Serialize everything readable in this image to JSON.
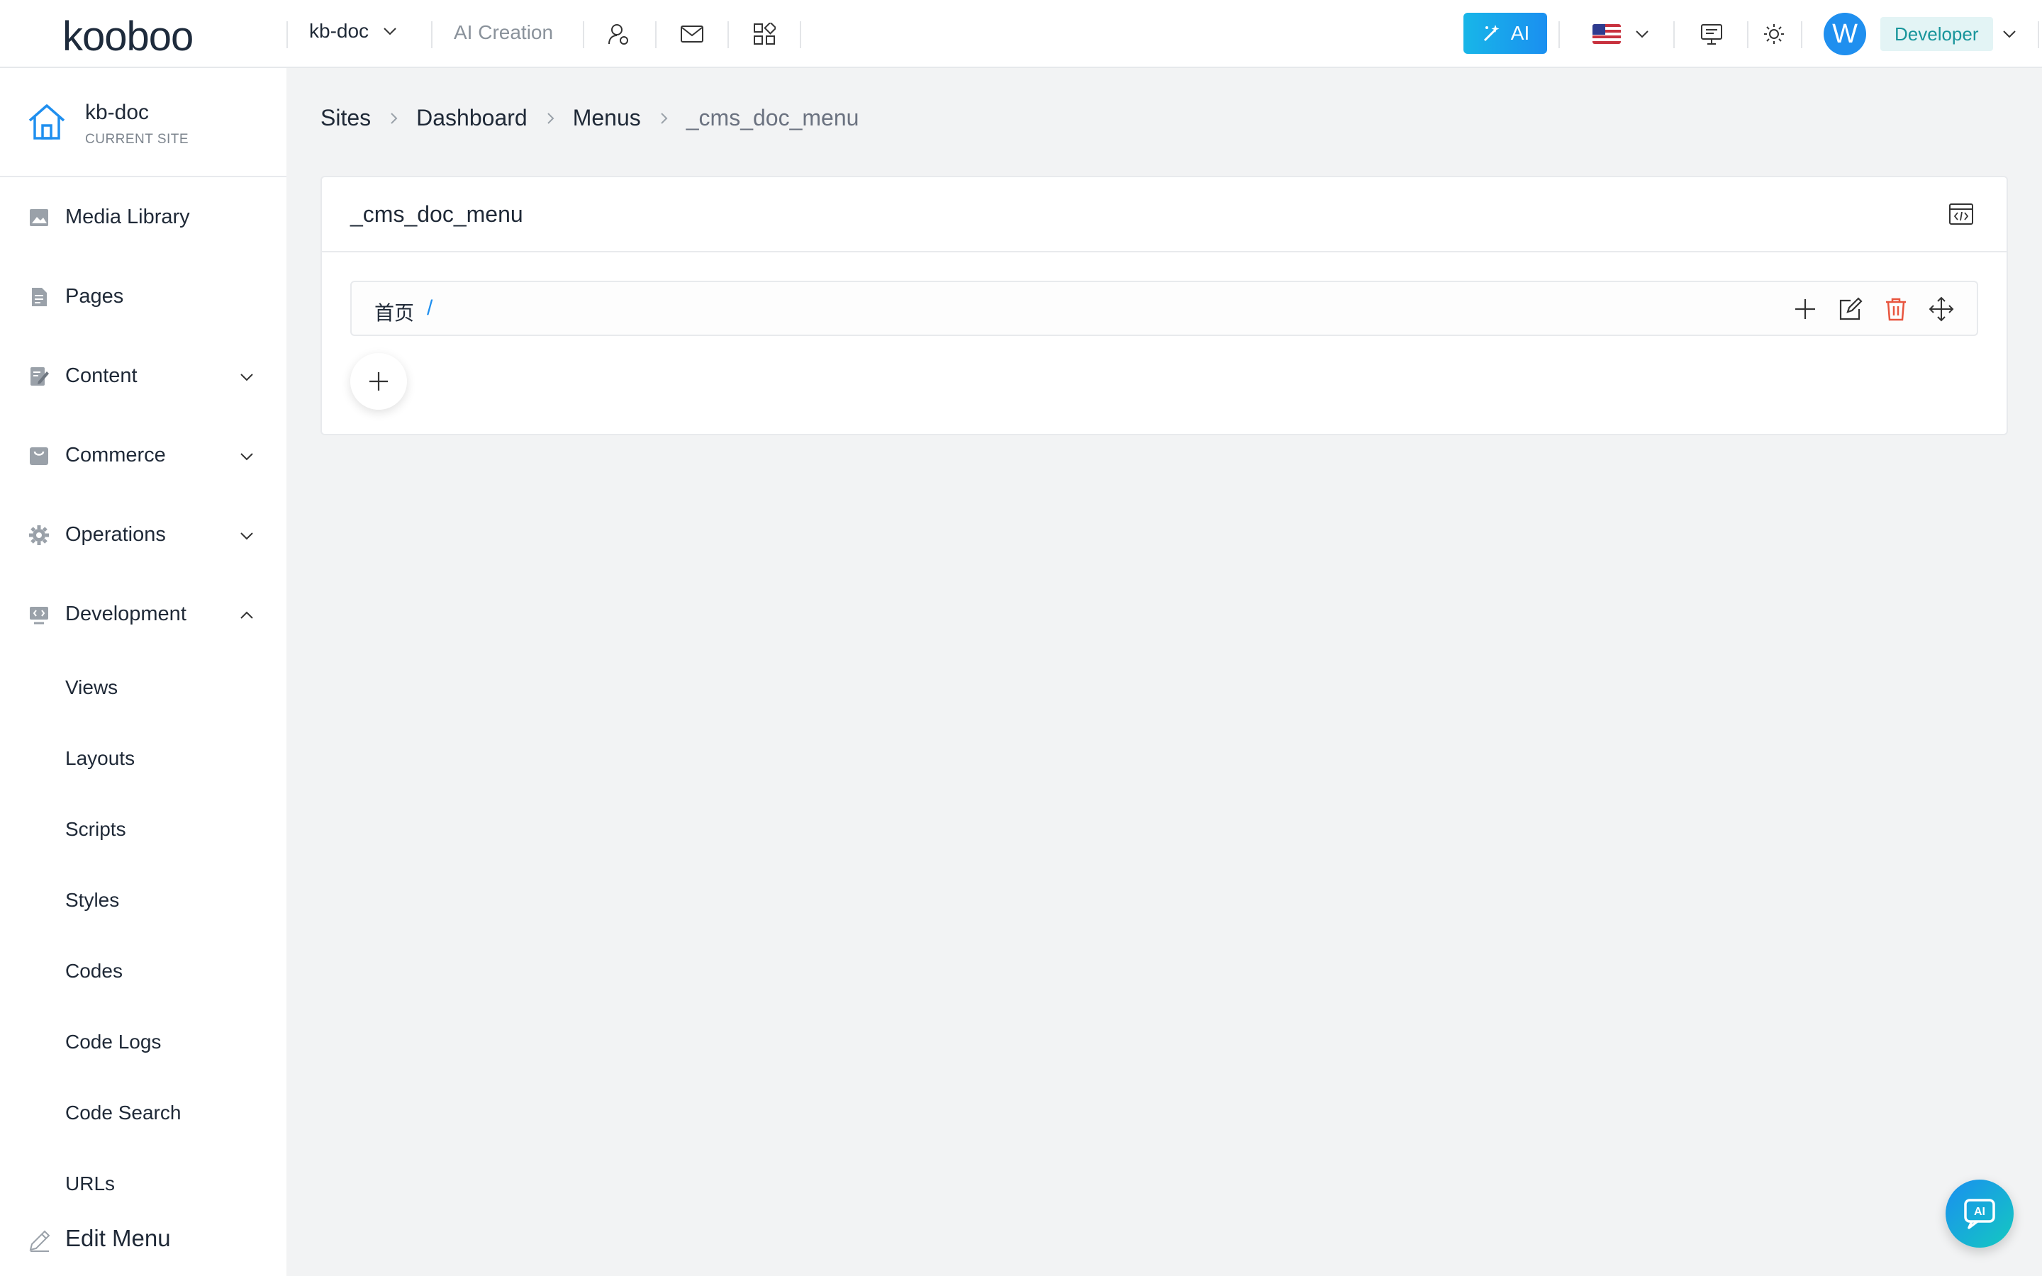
{
  "header": {
    "logo": "kooboo",
    "site": "kb-doc",
    "ai_creation": "AI Creation",
    "ai_button": "AI",
    "avatar_letter": "W",
    "role": "Developer"
  },
  "sidebar": {
    "current_site": {
      "name": "kb-doc",
      "label": "CURRENT SITE"
    },
    "items": [
      {
        "label": "Media Library",
        "icon": "image-icon"
      },
      {
        "label": "Pages",
        "icon": "page-icon"
      },
      {
        "label": "Content",
        "icon": "content-icon",
        "expandable": true
      },
      {
        "label": "Commerce",
        "icon": "shop-icon",
        "expandable": true
      },
      {
        "label": "Operations",
        "icon": "gear-icon",
        "expandable": true
      },
      {
        "label": "Development",
        "icon": "code-icon",
        "expandable": true,
        "expanded": true
      }
    ],
    "dev_children": [
      "Views",
      "Layouts",
      "Scripts",
      "Styles",
      "Codes",
      "Code Logs",
      "Code Search",
      "URLs"
    ],
    "edit_menu": "Edit Menu"
  },
  "breadcrumb": [
    "Sites",
    "Dashboard",
    "Menus",
    "_cms_doc_menu"
  ],
  "card": {
    "title": "_cms_doc_menu",
    "menu_items": [
      {
        "name": "首页",
        "url": "/"
      }
    ]
  },
  "colors": {
    "accent": "#1f8fef",
    "danger": "#e8553e",
    "teal": "#18959b",
    "background": "#f2f3f4"
  }
}
